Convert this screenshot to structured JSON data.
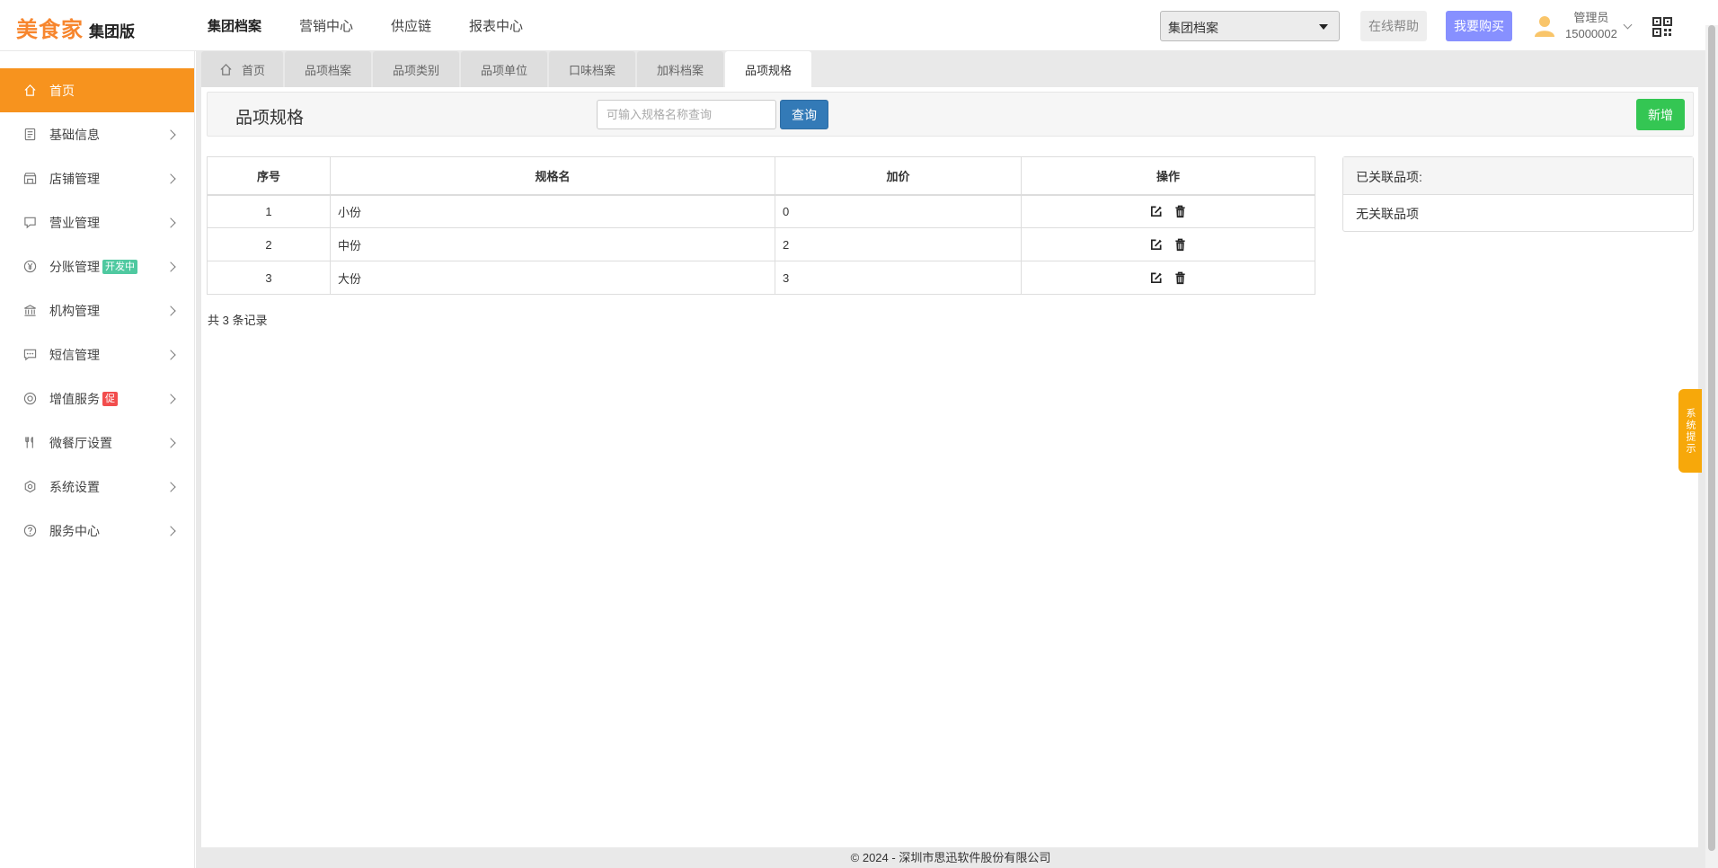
{
  "header": {
    "logo_main": "美食家",
    "logo_sub": "集团版",
    "nav": [
      "集团档案",
      "营销中心",
      "供应链",
      "报表中心"
    ],
    "org_select_value": "集团档案",
    "help_label": "在线帮助",
    "buy_label": "我要购买",
    "user_role": "管理员",
    "user_id": "15000002"
  },
  "sidebar": {
    "items": [
      {
        "label": "首页"
      },
      {
        "label": "基础信息"
      },
      {
        "label": "店铺管理"
      },
      {
        "label": "营业管理"
      },
      {
        "label": "分账管理",
        "badge": "开发中"
      },
      {
        "label": "机构管理"
      },
      {
        "label": "短信管理"
      },
      {
        "label": "增值服务",
        "badge": "促"
      },
      {
        "label": "微餐厅设置"
      },
      {
        "label": "系统设置"
      },
      {
        "label": "服务中心"
      }
    ]
  },
  "tabs": [
    "首页",
    "品项档案",
    "品项类别",
    "品项单位",
    "口味档案",
    "加料档案",
    "品项规格"
  ],
  "toolbar": {
    "title": "品项规格",
    "search_placeholder": "可输入规格名称查询",
    "query_label": "查询",
    "add_label": "新增"
  },
  "table": {
    "headers": [
      "序号",
      "规格名",
      "加价",
      "操作"
    ],
    "rows": [
      {
        "no": "1",
        "name": "小份",
        "price": "0"
      },
      {
        "no": "2",
        "name": "中份",
        "price": "2"
      },
      {
        "no": "3",
        "name": "大份",
        "price": "3"
      }
    ],
    "record_count": "共 3 条记录"
  },
  "linked": {
    "title": "已关联品项:",
    "empty": "无关联品项"
  },
  "footer": "© 2024 - 深圳市思迅软件股份有限公司",
  "system_tip": "系统提示",
  "colors": {
    "brand": "#f7862e",
    "sidebar_active": "#f7931e",
    "primary": "#337ab7",
    "success": "#34c653",
    "buy": "#8790ff"
  }
}
